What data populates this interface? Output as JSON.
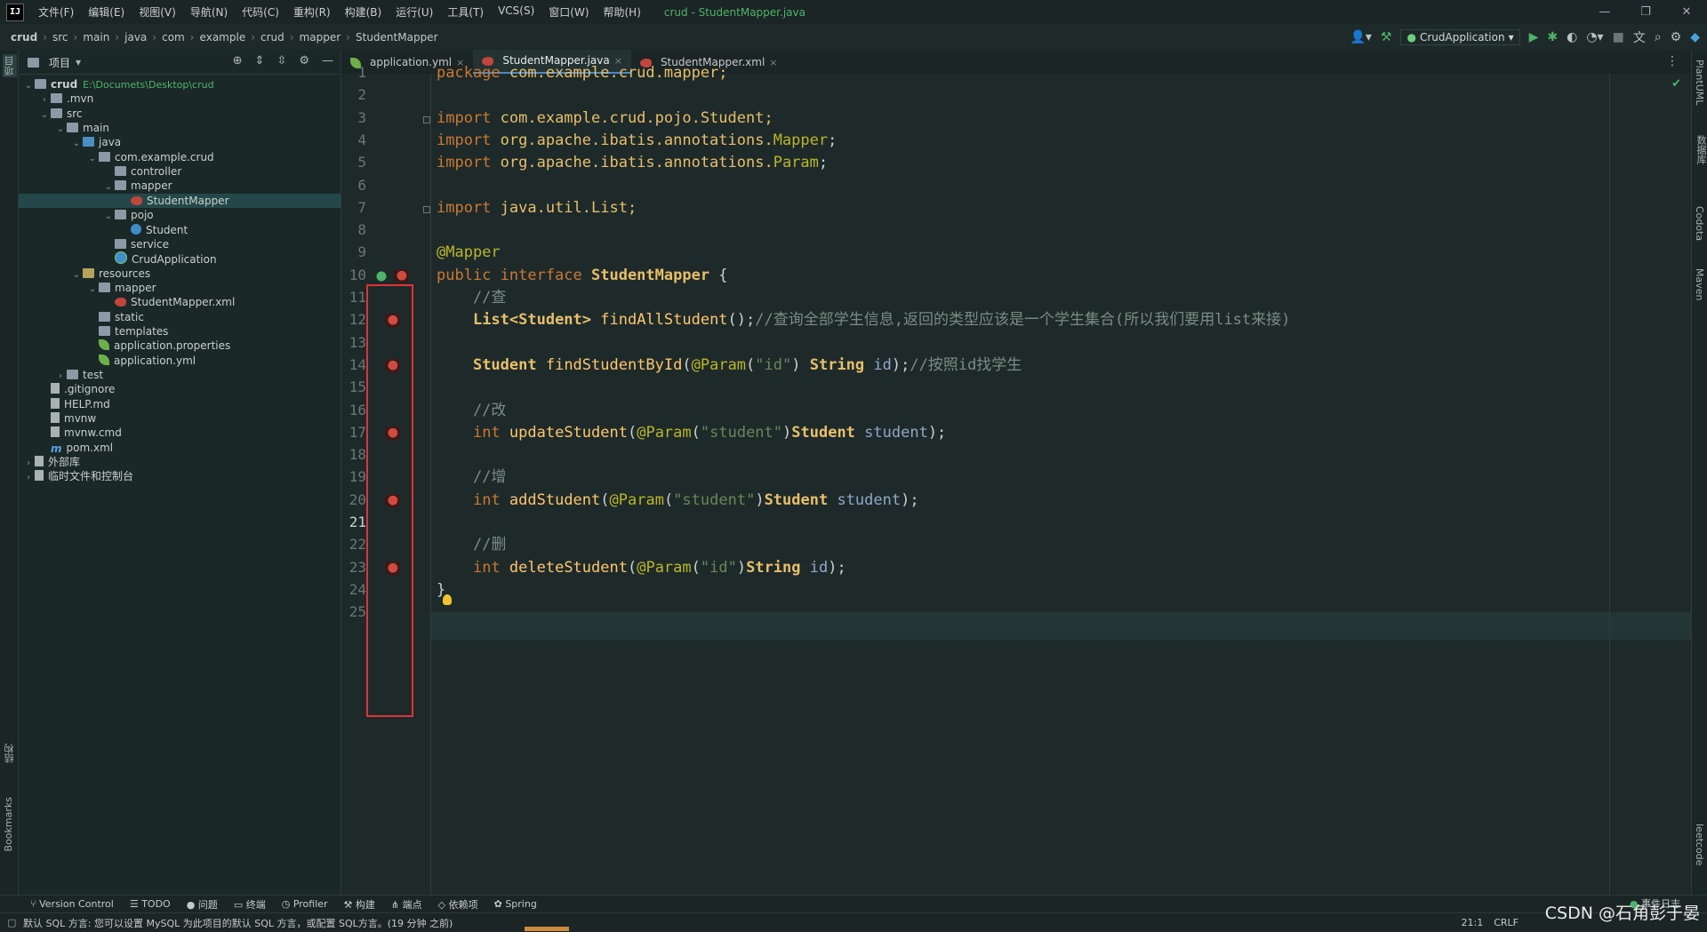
{
  "titlebar": {
    "logo": "IJ",
    "menus": [
      "文件(F)",
      "编辑(E)",
      "视图(V)",
      "导航(N)",
      "代码(C)",
      "重构(R)",
      "构建(B)",
      "运行(U)",
      "工具(T)",
      "VCS(S)",
      "窗口(W)",
      "帮助(H)"
    ],
    "title": "crud - StudentMapper.java",
    "min": "—",
    "max": "❐",
    "close": "✕"
  },
  "navbar": {
    "crumbs": [
      "crud",
      "src",
      "main",
      "java",
      "com",
      "example",
      "crud",
      "mapper",
      "StudentMapper"
    ],
    "run_config": "CrudApplication"
  },
  "stripe": {
    "project": "项目",
    "structure": "结构",
    "bookmarks": "Bookmarks"
  },
  "right_stripe": {
    "plantuml": "PlantUML",
    "database": "数据库",
    "codota": "Codota",
    "maven": "Maven",
    "leetcode": "leetcode"
  },
  "project": {
    "title": "项目",
    "tree": [
      {
        "label": "crud",
        "icon": "folder",
        "indent": 0,
        "arrow": "v",
        "path": "E:\\Documets\\Desktop\\crud"
      },
      {
        "label": ".mvn",
        "icon": "folder",
        "indent": 1,
        "arrow": ">"
      },
      {
        "label": "src",
        "icon": "folder",
        "indent": 1,
        "arrow": "v"
      },
      {
        "label": "main",
        "icon": "folder",
        "indent": 2,
        "arrow": "v"
      },
      {
        "label": "java",
        "icon": "src",
        "indent": 3,
        "arrow": "v"
      },
      {
        "label": "com.example.crud",
        "icon": "folder",
        "indent": 4,
        "arrow": "v"
      },
      {
        "label": "controller",
        "icon": "folder",
        "indent": 5,
        "arrow": ""
      },
      {
        "label": "mapper",
        "icon": "folder",
        "indent": 5,
        "arrow": "v"
      },
      {
        "label": "StudentMapper",
        "icon": "bird",
        "indent": 6,
        "arrow": "",
        "selected": true
      },
      {
        "label": "pojo",
        "icon": "folder",
        "indent": 5,
        "arrow": "v"
      },
      {
        "label": "Student",
        "icon": "class",
        "indent": 6,
        "arrow": ""
      },
      {
        "label": "service",
        "icon": "folder",
        "indent": 5,
        "arrow": ""
      },
      {
        "label": "CrudApplication",
        "icon": "app",
        "indent": 5,
        "arrow": ""
      },
      {
        "label": "resources",
        "icon": "res",
        "indent": 3,
        "arrow": "v"
      },
      {
        "label": "mapper",
        "icon": "folder",
        "indent": 4,
        "arrow": "v"
      },
      {
        "label": "StudentMapper.xml",
        "icon": "bird",
        "indent": 5,
        "arrow": ""
      },
      {
        "label": "static",
        "icon": "folder",
        "indent": 4,
        "arrow": ""
      },
      {
        "label": "templates",
        "icon": "folder",
        "indent": 4,
        "arrow": ""
      },
      {
        "label": "application.properties",
        "icon": "leaf",
        "indent": 4,
        "arrow": ""
      },
      {
        "label": "application.yml",
        "icon": "leaf",
        "indent": 4,
        "arrow": ""
      },
      {
        "label": "test",
        "icon": "folder",
        "indent": 2,
        "arrow": ">"
      },
      {
        "label": ".gitignore",
        "icon": "file",
        "indent": 1,
        "arrow": ""
      },
      {
        "label": "HELP.md",
        "icon": "file",
        "indent": 1,
        "arrow": ""
      },
      {
        "label": "mvnw",
        "icon": "file",
        "indent": 1,
        "arrow": ""
      },
      {
        "label": "mvnw.cmd",
        "icon": "file",
        "indent": 1,
        "arrow": ""
      },
      {
        "label": "pom.xml",
        "icon": "m",
        "indent": 1,
        "arrow": ""
      },
      {
        "label": "外部库",
        "icon": "file",
        "indent": 0,
        "arrow": ">"
      },
      {
        "label": "临时文件和控制台",
        "icon": "file",
        "indent": 0,
        "arrow": ">"
      }
    ]
  },
  "tabs": [
    {
      "label": "application.yml",
      "active": false
    },
    {
      "label": "StudentMapper.java",
      "active": true
    },
    {
      "label": "StudentMapper.xml",
      "active": false
    }
  ],
  "editor": {
    "current_line": 21,
    "lines": [
      [
        {
          "t": "package ",
          "c": "kw"
        },
        {
          "t": "com.example.crud.mapper;",
          "c": "pkg"
        }
      ],
      [],
      [
        {
          "t": "import ",
          "c": "kw"
        },
        {
          "t": "com.example.crud.pojo.Student;",
          "c": "pkg"
        }
      ],
      [
        {
          "t": "import ",
          "c": "kw"
        },
        {
          "t": "org.apache.ibatis.annotations.",
          "c": "pkg"
        },
        {
          "t": "Mapper",
          "c": "ann"
        },
        {
          "t": ";",
          "c": "plain"
        }
      ],
      [
        {
          "t": "import ",
          "c": "kw"
        },
        {
          "t": "org.apache.ibatis.annotations.",
          "c": "pkg"
        },
        {
          "t": "Param",
          "c": "ann"
        },
        {
          "t": ";",
          "c": "plain"
        }
      ],
      [],
      [
        {
          "t": "import ",
          "c": "kw"
        },
        {
          "t": "java.util.List;",
          "c": "pkg"
        }
      ],
      [],
      [
        {
          "t": "@Mapper",
          "c": "ann"
        }
      ],
      [
        {
          "t": "public interface ",
          "c": "kw"
        },
        {
          "t": "StudentMapper ",
          "c": "type"
        },
        {
          "t": "{",
          "c": "plain"
        }
      ],
      [
        {
          "t": "    //查",
          "c": "comment"
        }
      ],
      [
        {
          "t": "    ",
          "c": "plain"
        },
        {
          "t": "List<Student> ",
          "c": "type"
        },
        {
          "t": "findAllStudent",
          "c": "method"
        },
        {
          "t": "();",
          "c": "plain"
        },
        {
          "t": "//查询全部学生信息,返回的类型应该是一个学生集合(所以我们要用list来接)",
          "c": "comment"
        }
      ],
      [],
      [
        {
          "t": "    ",
          "c": "plain"
        },
        {
          "t": "Student ",
          "c": "type"
        },
        {
          "t": "findStudentById",
          "c": "method"
        },
        {
          "t": "(",
          "c": "plain"
        },
        {
          "t": "@Param",
          "c": "ann"
        },
        {
          "t": "(",
          "c": "plain"
        },
        {
          "t": "\"id\"",
          "c": "str"
        },
        {
          "t": ") ",
          "c": "plain"
        },
        {
          "t": "String ",
          "c": "type"
        },
        {
          "t": "id",
          "c": "param"
        },
        {
          "t": ");",
          "c": "plain"
        },
        {
          "t": "//按照id找学生",
          "c": "comment"
        }
      ],
      [],
      [
        {
          "t": "    //改",
          "c": "comment"
        }
      ],
      [
        {
          "t": "    ",
          "c": "plain"
        },
        {
          "t": "int ",
          "c": "kw"
        },
        {
          "t": "updateStudent",
          "c": "method"
        },
        {
          "t": "(",
          "c": "plain"
        },
        {
          "t": "@Param",
          "c": "ann"
        },
        {
          "t": "(",
          "c": "plain"
        },
        {
          "t": "\"student\"",
          "c": "str"
        },
        {
          "t": ")",
          "c": "plain"
        },
        {
          "t": "Student ",
          "c": "type"
        },
        {
          "t": "student",
          "c": "param"
        },
        {
          "t": ");",
          "c": "plain"
        }
      ],
      [],
      [
        {
          "t": "    //增",
          "c": "comment"
        }
      ],
      [
        {
          "t": "    ",
          "c": "plain"
        },
        {
          "t": "int ",
          "c": "kw"
        },
        {
          "t": "addStudent",
          "c": "method"
        },
        {
          "t": "(",
          "c": "plain"
        },
        {
          "t": "@Param",
          "c": "ann"
        },
        {
          "t": "(",
          "c": "plain"
        },
        {
          "t": "\"student\"",
          "c": "str"
        },
        {
          "t": ")",
          "c": "plain"
        },
        {
          "t": "Student ",
          "c": "type"
        },
        {
          "t": "student",
          "c": "param"
        },
        {
          "t": ");",
          "c": "plain"
        }
      ],
      [],
      [
        {
          "t": "    //删",
          "c": "comment"
        }
      ],
      [
        {
          "t": "    ",
          "c": "plain"
        },
        {
          "t": "int ",
          "c": "kw"
        },
        {
          "t": "deleteStudent",
          "c": "method"
        },
        {
          "t": "(",
          "c": "plain"
        },
        {
          "t": "@Param",
          "c": "ann"
        },
        {
          "t": "(",
          "c": "plain"
        },
        {
          "t": "\"id\"",
          "c": "str"
        },
        {
          "t": ")",
          "c": "plain"
        },
        {
          "t": "String ",
          "c": "type"
        },
        {
          "t": "id",
          "c": "param"
        },
        {
          "t": ");",
          "c": "plain"
        }
      ],
      [
        {
          "t": "}",
          "c": "plain"
        }
      ],
      []
    ],
    "gutter_icons": [
      {
        "line": 10,
        "icon": "interface"
      },
      {
        "line": 10,
        "icon": "mybatis-bird"
      },
      {
        "line": 12,
        "icon": "mybatis-bird"
      },
      {
        "line": 14,
        "icon": "mybatis-bird"
      },
      {
        "line": 17,
        "icon": "mybatis-bird"
      },
      {
        "line": 20,
        "icon": "mybatis-bird"
      },
      {
        "line": 23,
        "icon": "mybatis-bird"
      }
    ]
  },
  "bottom_tools": [
    "Version Control",
    "TODO",
    "问题",
    "终端",
    "Profiler",
    "构建",
    "端点",
    "依赖项",
    "Spring"
  ],
  "event_log": "事件日志",
  "status": {
    "message": "默认 SQL 方言: 您可以设置 MySQL 为此项目的默认 SQL 方言，或配置 SQL方言。(19 分钟 之前)",
    "position": "21:1",
    "line_sep": "CRLF"
  },
  "watermark": "CSDN @石角彭于晏"
}
